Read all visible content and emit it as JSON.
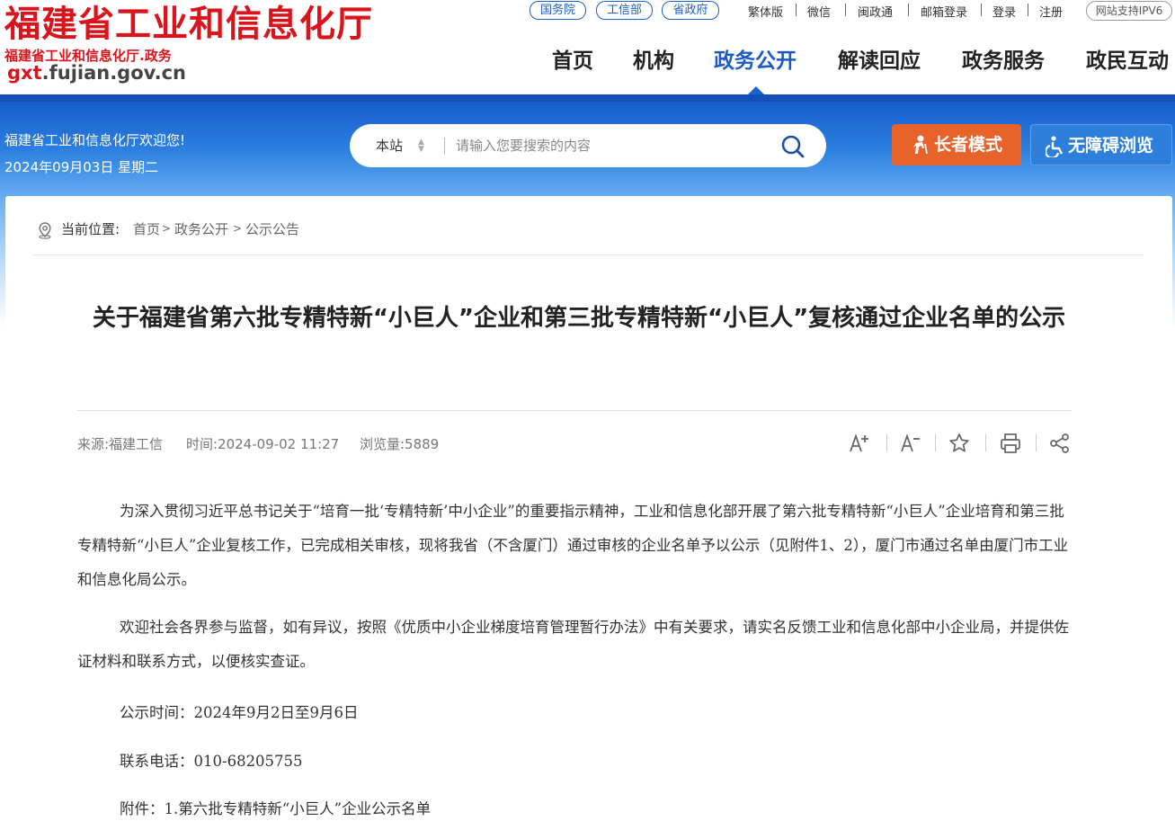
{
  "header": {
    "site_title": "福建省工业和信息化厅",
    "site_subtitle": "福建省工业和信息化厅.政务",
    "domain_prefix": "gxt",
    "domain_rest": ".fujian.gov.cn",
    "pills": [
      "国务院",
      "工信部",
      "省政府"
    ],
    "top_links": [
      "繁体版",
      "微信",
      "闽政通",
      "邮箱登录",
      "登录",
      "注册"
    ],
    "ipv6": "网站支持IPV6",
    "nav": [
      "首页",
      "机构",
      "政务公开",
      "解读回应",
      "政务服务",
      "政民互动"
    ],
    "active_nav": "政务公开"
  },
  "banner": {
    "welcome": "福建省工业和信息化厅欢迎您!",
    "date": "2024年09月03日 星期二",
    "search_scope": "本站",
    "search_placeholder": "请输入您要搜索的内容",
    "elder_mode": "长者模式",
    "accessible": "无障碍浏览"
  },
  "breadcrumb": {
    "label": "当前位置:",
    "items": [
      "首页",
      "政务公开",
      "公示公告"
    ],
    "separator": ">"
  },
  "article": {
    "title": "关于福建省第六批专精特新“小巨人”企业和第三批专精特新“小巨人”复核通过企业名单的公示",
    "source": "来源:福建工信",
    "time": "时间:2024-09-02 11:27",
    "views": "浏览量:5889",
    "tools": [
      "font-increase-icon",
      "font-decrease-icon",
      "favorite-star-icon",
      "print-icon",
      "share-icon"
    ],
    "paragraphs": [
      "为深入贯彻习近平总书记关于“培育一批‘专精特新’中小企业”的重要指示精神，工业和信息化部开展了第六批专精特新“小巨人”企业培育和第三批专精特新“小巨人”企业复核工作，已完成相关审核，现将我省（不含厦门）通过审核的企业名单予以公示（见附件1、2），厦门市通过名单由厦门市工业和信息化局公示。",
      "欢迎社会各界参与监督，如有异议，按照《优质中小企业梯度培育管理暂行办法》中有关要求，请实名反馈工业和信息化部中小企业局，并提供佐证材料和联系方式，以便核实查证。"
    ],
    "notice_time": "公示时间：2024年9月2日至9月6日",
    "contact": "联系电话：010-68205755",
    "attachment": "附件：1.第六批专精特新“小巨人”企业公示名单"
  },
  "colors": {
    "brand_red": "#d8141c",
    "nav_active": "#1a5bc4",
    "elder_orange": "#e8632a",
    "access_blue": "#2e7fdc"
  }
}
